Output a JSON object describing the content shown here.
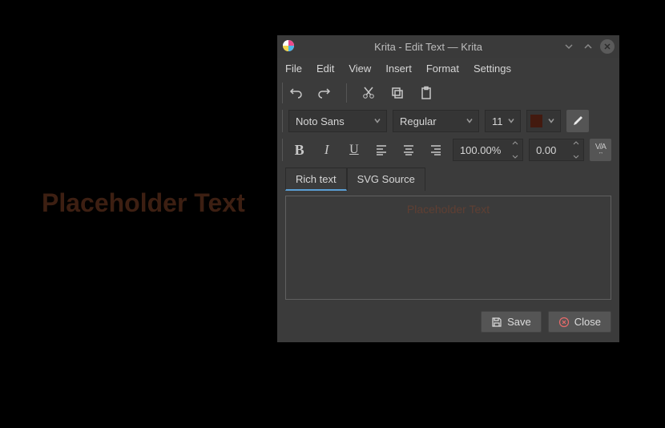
{
  "canvas": {
    "text": "Placeholder Text"
  },
  "dialog": {
    "title": "Krita - Edit Text — Krita",
    "menu": {
      "file": "File",
      "edit": "Edit",
      "view": "View",
      "insert": "Insert",
      "format": "Format",
      "settings": "Settings"
    },
    "font": {
      "family": "Noto Sans",
      "weight": "Regular",
      "size": "11"
    },
    "lineHeight": "100.00%",
    "letterSpacing": "0.00",
    "tabs": {
      "rich": "Rich text",
      "svg": "SVG Source"
    },
    "editorText": "Placeholder Text",
    "buttons": {
      "save": "Save",
      "close": "Close"
    }
  }
}
